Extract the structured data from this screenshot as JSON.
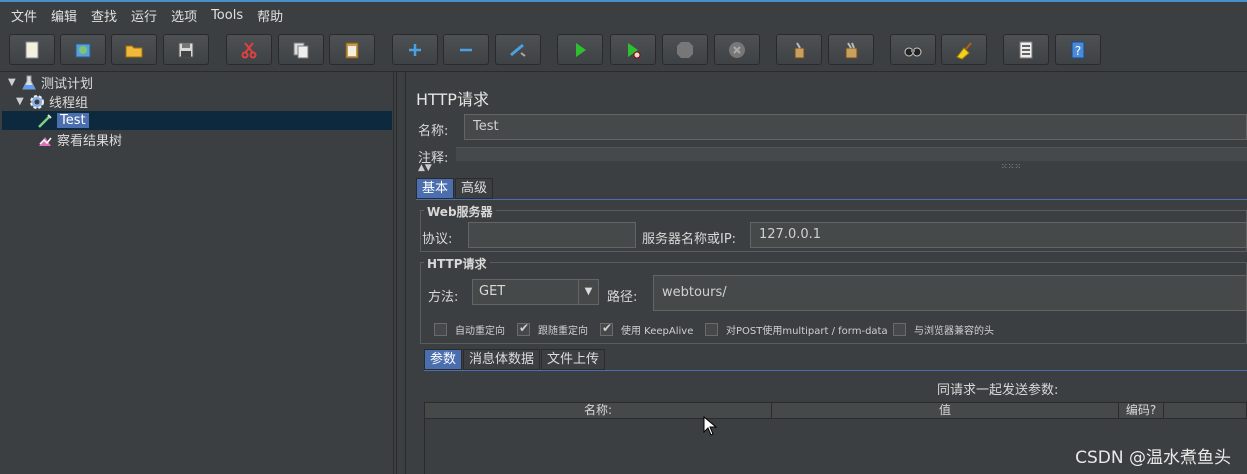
{
  "menubar": {
    "items": [
      "文件",
      "编辑",
      "查找",
      "运行",
      "选项",
      "Tools",
      "帮助"
    ]
  },
  "toolbar": {
    "buttons": [
      {
        "name": "new-icon"
      },
      {
        "name": "templates-icon"
      },
      {
        "name": "open-icon"
      },
      {
        "name": "save-icon"
      },
      {
        "name": "cut-icon"
      },
      {
        "name": "copy-icon"
      },
      {
        "name": "paste-icon"
      },
      {
        "name": "expand-icon"
      },
      {
        "name": "collapse-icon"
      },
      {
        "name": "toggle-icon"
      },
      {
        "name": "start-icon"
      },
      {
        "name": "start-no-pause-icon"
      },
      {
        "name": "stop-icon"
      },
      {
        "name": "shutdown-icon"
      },
      {
        "name": "clear-icon"
      },
      {
        "name": "clear-all-icon"
      },
      {
        "name": "search-icon"
      },
      {
        "name": "reset-search-icon"
      },
      {
        "name": "function-helper-icon"
      },
      {
        "name": "help-icon"
      }
    ]
  },
  "tree": {
    "items": [
      {
        "label": "测试计划",
        "icon": "test-plan-icon"
      },
      {
        "label": "线程组",
        "icon": "thread-group-icon"
      },
      {
        "label": "Test",
        "icon": "sampler-icon"
      },
      {
        "label": "察看结果树",
        "icon": "listener-icon"
      }
    ]
  },
  "panel": {
    "title": "HTTP请求",
    "name_label": "名称:",
    "name_value": "Test",
    "comment_label": "注释:",
    "tabs": [
      "基本",
      "高级"
    ],
    "web_server": {
      "title": "Web服务器",
      "protocol_label": "协议:",
      "protocol_value": "",
      "server_label": "服务器名称或IP:",
      "server_value": "127.0.0.1"
    },
    "http_request": {
      "title": "HTTP请求",
      "method_label": "方法:",
      "method_value": "GET",
      "path_label": "路径:",
      "path_value": "webtours/"
    },
    "checkboxes": [
      {
        "label": "自动重定向",
        "checked": false
      },
      {
        "label": "跟随重定向",
        "checked": true
      },
      {
        "label": "使用 KeepAlive",
        "checked": true
      },
      {
        "label": "对POST使用multipart / form-data",
        "checked": false
      },
      {
        "label": "与浏览器兼容的头",
        "checked": false
      }
    ],
    "sub_tabs": [
      "参数",
      "消息体数据",
      "文件上传"
    ],
    "params_caption": "同请求一起发送参数:",
    "table_headers": [
      "名称:",
      "值",
      "编码?"
    ]
  },
  "watermark": "CSDN @温水煮鱼头",
  "colors": {
    "accent": "#4b6eaf",
    "background": "#3c3f41",
    "selection": "#0d293e"
  }
}
